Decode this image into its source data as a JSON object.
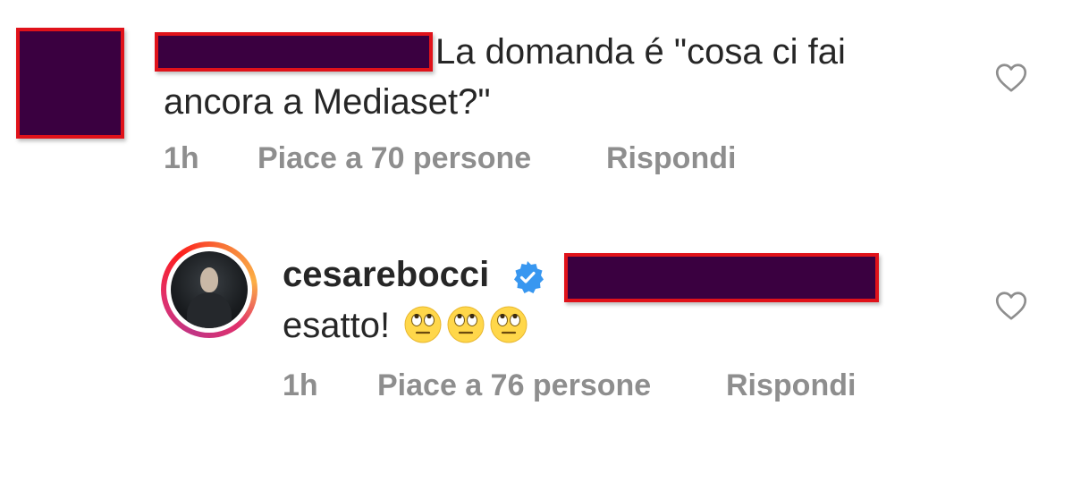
{
  "comments": [
    {
      "text_line1": "La domanda é \"cosa ci fai",
      "text_line2": "ancora a Mediaset?\"",
      "time": "1h",
      "likes": "Piace a 70 persone",
      "reply_label": "Rispondi"
    }
  ],
  "reply": {
    "username": "cesarebocci",
    "text": "esatto!",
    "emojis": [
      "face-with-rolling-eyes",
      "face-with-rolling-eyes",
      "face-with-rolling-eyes"
    ],
    "time": "1h",
    "likes": "Piace a 76 persone",
    "reply_label": "Rispondi"
  },
  "icons": {
    "like": "heart-outline-icon",
    "verified": "verified-badge-icon"
  },
  "colors": {
    "text": "#262626",
    "meta": "#8e8e8e",
    "verified": "#3897f0",
    "redaction_fill": "#3a0040",
    "redaction_border": "#e0121a"
  }
}
